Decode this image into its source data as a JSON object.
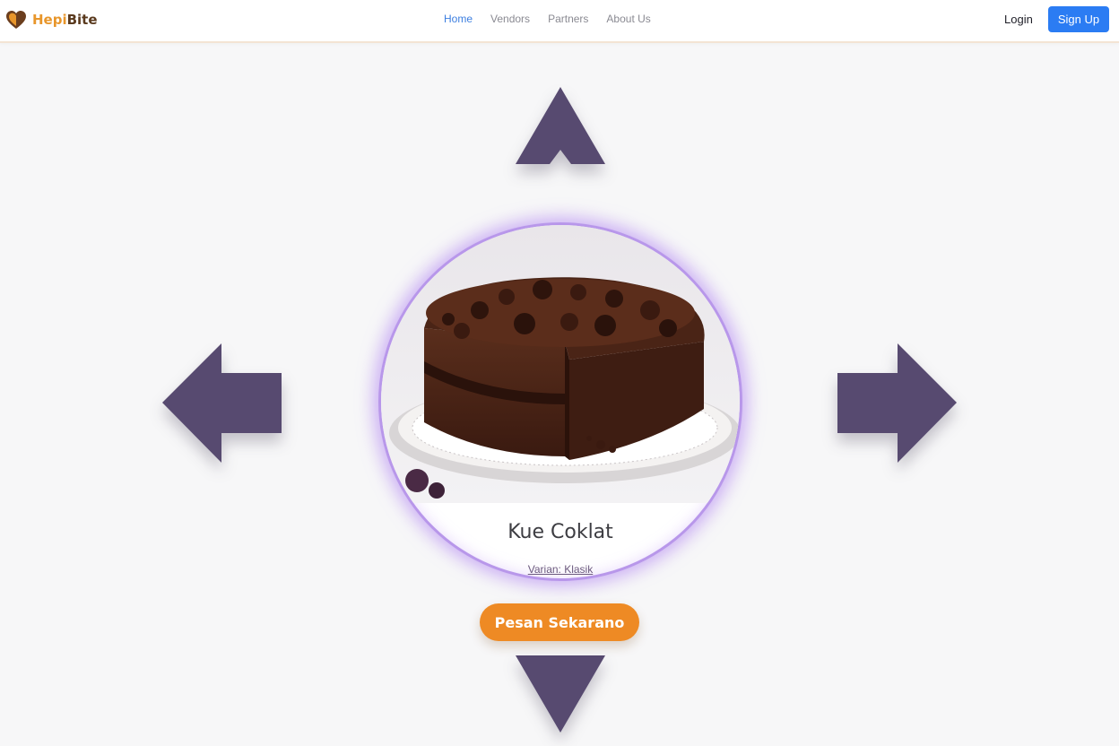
{
  "brand": {
    "part1": "Hepi",
    "part2": "Bite",
    "logo_icon": "heart-logo-icon"
  },
  "nav": {
    "items": [
      {
        "label": "Home",
        "active": true
      },
      {
        "label": "Vendors",
        "active": false
      },
      {
        "label": "Partners",
        "active": false
      },
      {
        "label": "About Us",
        "active": false
      }
    ]
  },
  "auth": {
    "login_label": "Login",
    "signup_label": "Sign Up"
  },
  "product": {
    "name": "Kue Coklat",
    "variant": "Varian: Klasik",
    "image_icon": "chocolate-cake-image",
    "order_label": "Pesan Sekarano"
  },
  "controls": {
    "up": "arrow-up-icon",
    "down": "arrow-down-icon",
    "left": "arrow-left-icon",
    "right": "arrow-right-icon"
  },
  "colors": {
    "accent": "#2b7cf3",
    "brand_orange": "#ee8a24",
    "arrow": "#574a70",
    "glow": "#b897ea"
  }
}
